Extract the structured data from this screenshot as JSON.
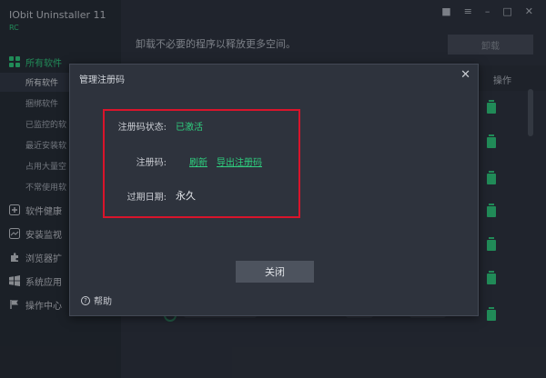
{
  "app": {
    "title": "IObit Uninstaller 11",
    "edition": "RC"
  },
  "sidebar": {
    "categories": [
      {
        "label": "所有软件",
        "icon": "grid-icon"
      },
      {
        "label": "软件健康",
        "icon": "health-icon"
      },
      {
        "label": "安装监视",
        "icon": "monitor-icon"
      },
      {
        "label": "浏览器扩",
        "icon": "puzzle-icon"
      },
      {
        "label": "系统应用",
        "icon": "windows-icon"
      },
      {
        "label": "操作中心",
        "icon": "flag-icon"
      }
    ],
    "subitems": [
      {
        "label": "所有软件"
      },
      {
        "label": "捆绑软件"
      },
      {
        "label": "已监控的软"
      },
      {
        "label": "最近安装软"
      },
      {
        "label": "占用大量空"
      },
      {
        "label": "不常使用软"
      }
    ]
  },
  "main": {
    "hint": "卸载不必要的程序以释放更多空间。",
    "uninstall_label": "卸载",
    "column_op": "操作"
  },
  "dialog": {
    "title": "管理注册码",
    "status_label": "注册码状态:",
    "status_value": "已激活",
    "code_label": "注册码:",
    "refresh_link": "刷新",
    "export_link": "导出注册码",
    "expiry_label": "过期日期:",
    "expiry_value": "永久",
    "close_button": "关闭",
    "help_label": "帮助"
  },
  "colors": {
    "accent": "#2fd07f",
    "highlight": "#d9142b",
    "background": "#2d323c"
  }
}
